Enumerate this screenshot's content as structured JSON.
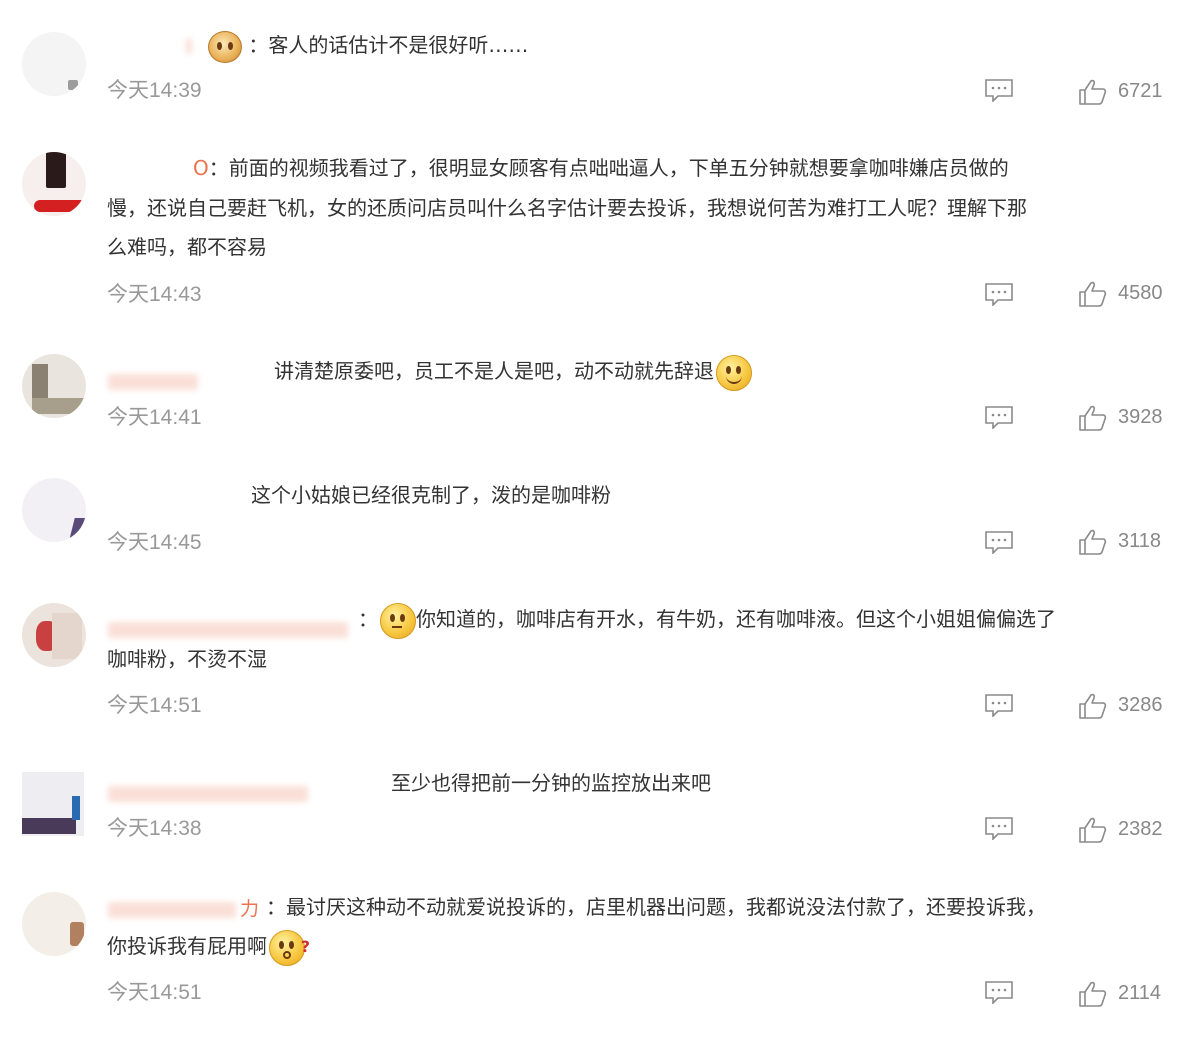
{
  "comments": [
    {
      "name_visible": "",
      "separator": "：",
      "text_lines": [
        "客人的话估计不是很好听……"
      ],
      "time": "今天14:39",
      "likes": "6721",
      "avatar_colors": [
        "#eaeaea",
        "#bbbbbb"
      ],
      "emoji": "crown-face"
    },
    {
      "name_visible": "O",
      "separator": "：",
      "text_lines": [
        "前面的视频我看过了，很明显女顾客有点咄咄逼人，下单五分钟就想要拿咖啡嫌店员做的",
        "慢，还说自己要赶飞机，女的还质问店员叫什么名字估计要去投诉，我想说何苦为难打工人呢？理解下那",
        "么难吗，都不容易"
      ],
      "time": "今天14:43",
      "likes": "4580",
      "avatar_colors": [
        "#f5e9e9",
        "#d42020"
      ]
    },
    {
      "name_visible": "",
      "separator": "",
      "text_lines": [
        "讲清楚原委吧，员工不是人是吧，动不动就先辞退"
      ],
      "time": "今天14:41",
      "likes": "3928",
      "avatar_colors": [
        "#e6e2da",
        "#8a8172"
      ],
      "emoji": "smile"
    },
    {
      "name_visible": "",
      "separator": "",
      "text_lines": [
        "这个小姑娘已经很克制了，泼的是咖啡粉"
      ],
      "time": "今天14:45",
      "likes": "3118",
      "avatar_colors": [
        "#f0eef4",
        "#5a4a7a"
      ]
    },
    {
      "name_visible": "",
      "separator": "：",
      "text_lines": [
        "你知道的，咖啡店有开水，有牛奶，还有咖啡液。但这个小姐姐偏偏选了",
        "咖啡粉，不烫不湿"
      ],
      "time": "今天14:51",
      "likes": "3286",
      "avatar_colors": [
        "#efe6e2",
        "#c84040"
      ],
      "emoji": "think"
    },
    {
      "name_visible": "",
      "separator": "",
      "text_lines": [
        "至少也得把前一分钟的监控放出来吧"
      ],
      "time": "今天14:38",
      "likes": "2382",
      "avatar_colors": [
        "#ecebf0",
        "#4a3a5a"
      ]
    },
    {
      "name_visible": "力",
      "separator": "：",
      "text_lines": [
        "最讨厌这种动不动就爱说投诉的，店里机器出问题，我都说没法付款了，还要投诉我，",
        "你投诉我有屁用啊"
      ],
      "time": "今天14:51",
      "likes": "2114",
      "avatar_colors": [
        "#f3ece6",
        "#b08060"
      ],
      "emoji": "question"
    }
  ],
  "icons": {
    "reply": "comment-bubble-icon",
    "like": "thumbs-up-icon"
  },
  "colors": {
    "username": "#eb7350",
    "meta": "#999999",
    "text": "#333333"
  }
}
